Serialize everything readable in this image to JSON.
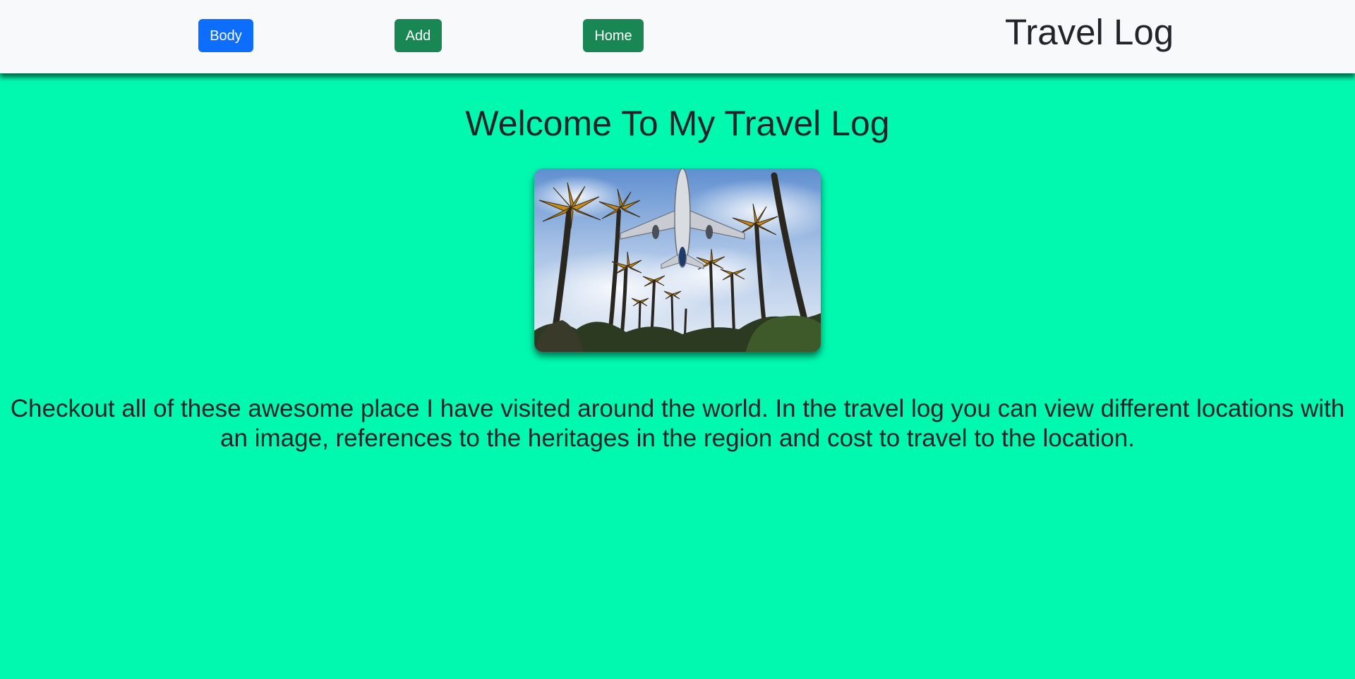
{
  "navbar": {
    "buttons": [
      {
        "label": "Body"
      },
      {
        "label": "Add"
      },
      {
        "label": "Home"
      }
    ],
    "brand": "Travel Log"
  },
  "main": {
    "heading": "Welcome To My Travel Log",
    "hero_image": "airplane-over-palm-trees",
    "description": "Checkout all of these awesome place I have visited around the world. In the travel log you can view different locations with an image, references to the heritages in the region and cost to travel to the location."
  },
  "colors": {
    "page_background": "#00f9ae",
    "navbar_background": "#f8f9fa",
    "primary_button": "#0d6efd",
    "success_button": "#198754",
    "text": "#212529"
  }
}
